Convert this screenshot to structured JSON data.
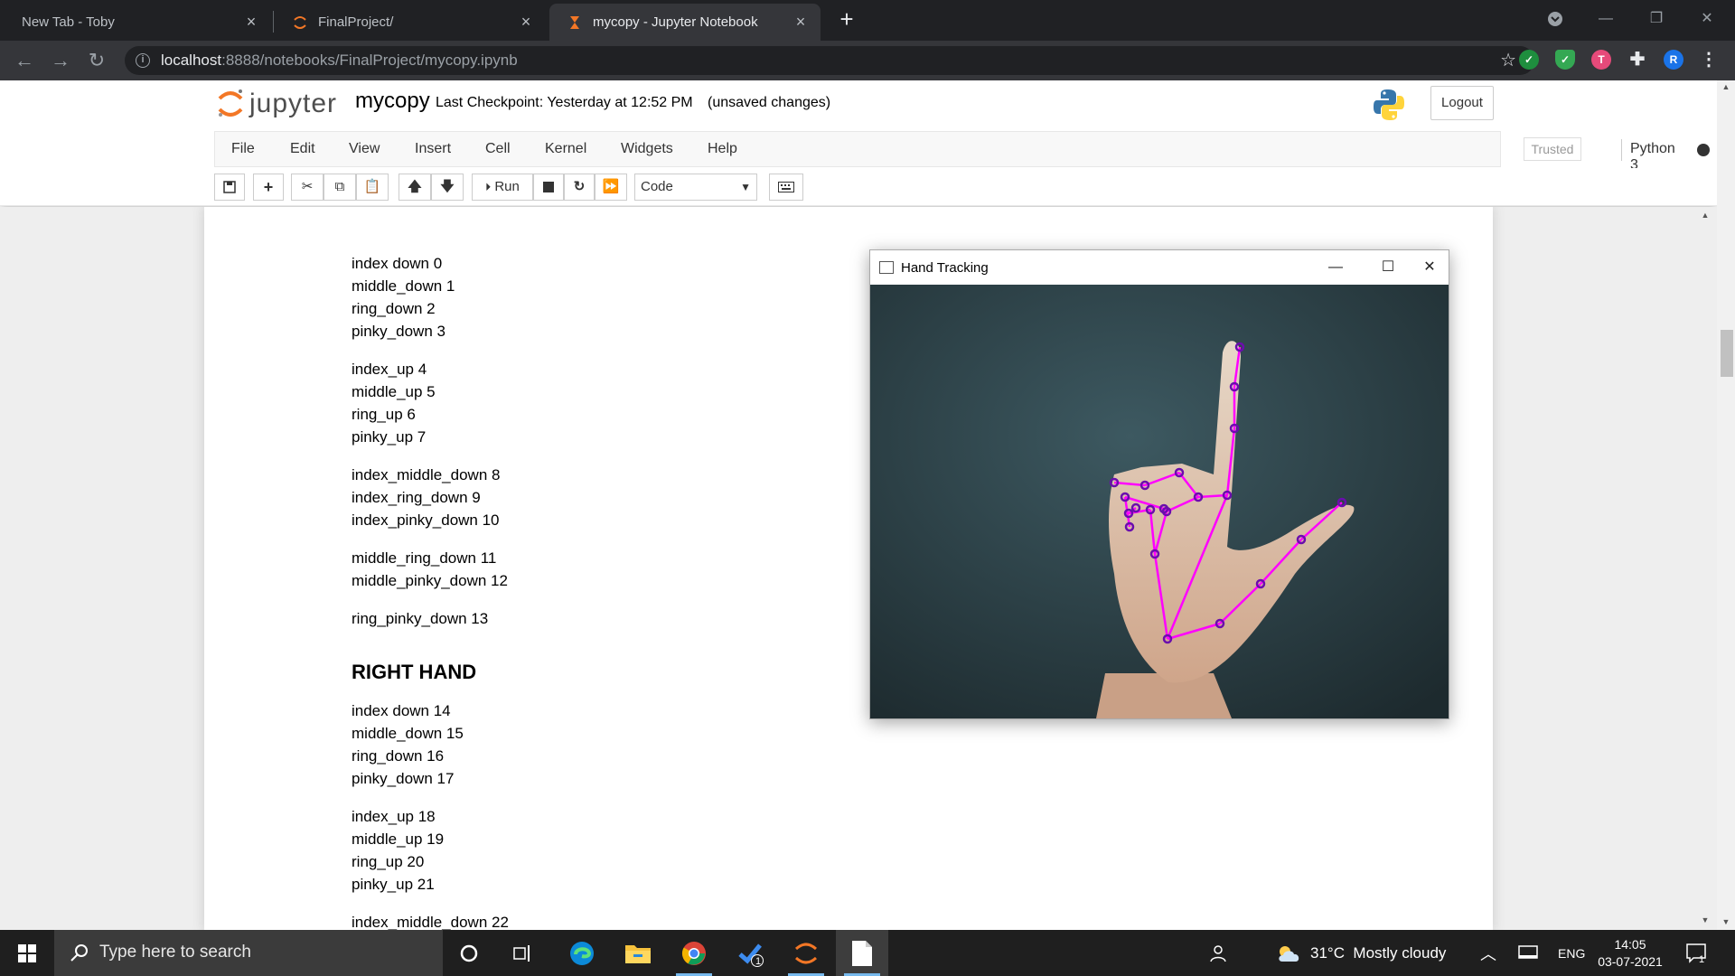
{
  "browser": {
    "tabs": [
      {
        "title": "New Tab - Toby",
        "active": false
      },
      {
        "title": "FinalProject/",
        "active": false
      },
      {
        "title": "mycopy - Jupyter Notebook",
        "active": true
      }
    ],
    "url_host": "localhost",
    "url_path": ":8888/notebooks/FinalProject/mycopy.ipynb",
    "profile_initial": "R",
    "extension_t": "T"
  },
  "jupyter": {
    "logo_text": "jupyter",
    "notebook_name": "mycopy",
    "checkpoint": "Last Checkpoint: Yesterday at 12:52 PM",
    "autosave_status": "(unsaved changes)",
    "logout_label": "Logout",
    "menu": [
      "File",
      "Edit",
      "View",
      "Insert",
      "Cell",
      "Kernel",
      "Widgets",
      "Help"
    ],
    "trusted_label": "Trusted",
    "kernel_name": "Python 3",
    "run_label": "Run",
    "cell_type": "Code"
  },
  "notebook": {
    "groups": [
      [
        "index down 0",
        "middle_down 1",
        "ring_down 2",
        "pinky_down 3"
      ],
      [
        "index_up 4",
        "middle_up 5",
        "ring_up 6",
        "pinky_up 7"
      ],
      [
        "index_middle_down 8",
        "index_ring_down 9",
        "index_pinky_down 10"
      ],
      [
        "middle_ring_down 11",
        "middle_pinky_down 12"
      ],
      [
        "ring_pinky_down 13"
      ]
    ],
    "heading": "RIGHT HAND",
    "right_groups": [
      [
        "index down 14",
        "middle_down 15",
        "ring_down 16",
        "pinky_down 17"
      ],
      [
        "index_up 18",
        "middle_up 19",
        "ring_up 20",
        "pinky_up 21"
      ],
      [
        "index_middle_down 22"
      ]
    ]
  },
  "hand_window": {
    "title": "Hand Tracking",
    "landmark_color": "#ff00ff",
    "point_color": "#6a0dad"
  },
  "taskbar": {
    "search_placeholder": "Type here to search",
    "weather": "31°C  Mostly cloudy",
    "language": "ENG",
    "time": "14:05",
    "date": "03-07-2021",
    "todo_badge": "1",
    "notification_count": "1"
  }
}
